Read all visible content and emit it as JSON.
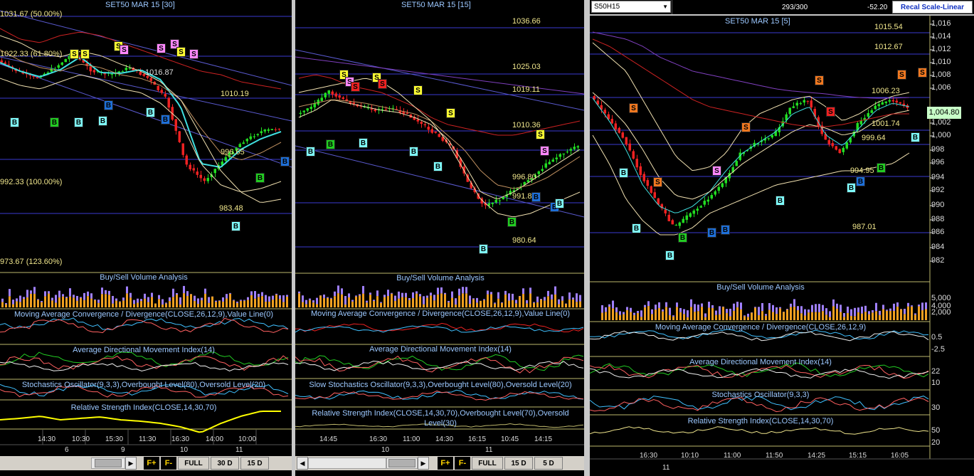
{
  "panels": [
    {
      "title": "SET50 MAR 15  [30]",
      "levels": [
        "1010.19",
        "996.65",
        "983.48",
        "1016.87"
      ],
      "fibs": [
        "1031.67 (50.00%)",
        "1022.33 (61.80%)",
        "992.33 (100.00%)",
        "973.67 (123.60%)"
      ],
      "indicators": [
        "Buy/Sell Volume Analysis",
        "Moving Average Convergence / Divergence(CLOSE,26,12,9),Value Line(0)",
        "Average Directional Movement Index(14)",
        "Stochastics Oscillator(9,3,3),Overbought Level(80),Oversold Level(20)",
        "Relative Strength Index(CLOSE,14,30,70)"
      ],
      "times": [
        "14:30",
        "10:30",
        "15:30",
        "11:30",
        "16:30",
        "14:00",
        "10:00"
      ],
      "dates": [
        "6",
        "9",
        "10",
        "11"
      ],
      "buttons": {
        "f_plus": "F+",
        "f_minus": "F-",
        "full": "FULL",
        "r1": "30 D",
        "r2": "15 D"
      }
    },
    {
      "title": "SET50 MAR 15  [15]",
      "levels": [
        "1036.66",
        "1025.03",
        "1019.11",
        "1010.36",
        "996.80",
        "991.89",
        "980.64"
      ],
      "indicators": [
        "Buy/Sell Volume Analysis",
        "Moving Average Convergence / Divergence(CLOSE,26,12,9),Value Line(0)",
        "Average Directional Movement Index(14)",
        "Slow Stochastics Oscillator(9,3,3),Overbought Level(80),Oversold Level(20)",
        "Relative Strength Index(CLOSE,14,30,70),Overbought Level(70),Oversold Level(30)"
      ],
      "times": [
        "14:45",
        "16:30",
        "11:00",
        "14:30",
        "16:15",
        "10:45",
        "14:15"
      ],
      "dates": [
        "10",
        "11"
      ],
      "buttons": {
        "f_plus": "F+",
        "f_minus": "F-",
        "full": "FULL",
        "r1": "15 D",
        "r2": "5 D"
      }
    },
    {
      "title": "SET50 MAR 15  [5]",
      "symbol": "S50H15",
      "counter": "293/300",
      "change": "-52.20",
      "recal": "Recal Scale-Linear",
      "price_tag": "1,004.80",
      "levels": [
        "1015.54",
        "1012.67",
        "1006.23",
        "1001.74",
        "999.64",
        "994.95",
        "987.01"
      ],
      "yaxis": [
        "1,016",
        "1,014",
        "1,012",
        "1,010",
        "1,008",
        "1,006",
        "1,002",
        "1,000",
        "998",
        "996",
        "994",
        "992",
        "990",
        "988",
        "986",
        "984",
        "982"
      ],
      "vol_axis": [
        "5,000",
        "4,000",
        "2,000"
      ],
      "macd_axis": [
        "0.5",
        "-2.5"
      ],
      "adx_axis": [
        "22",
        "10"
      ],
      "stoch_axis": [
        "30"
      ],
      "rsi_axis": [
        "50",
        "20"
      ],
      "indicators": [
        "Buy/Sell Volume Analysis",
        "Moving Average Convergence / Divergence(CLOSE,26,12,9)",
        "Average Directional Movement Index(14)",
        "Stochastics Oscillator(9,3,3)",
        "Relative Strength Index(CLOSE,14,30,70)"
      ],
      "times": [
        "16:30",
        "10:10",
        "11:00",
        "11:50",
        "14:25",
        "15:15",
        "16:05"
      ],
      "dates": [
        "11"
      ]
    }
  ],
  "colors": {
    "buy_cyan": "#7fffff",
    "buy_green": "#22cc22",
    "buy_blue": "#1e6fd8",
    "sell_yellow": "#ffff33",
    "sell_pink": "#ff88ff",
    "sell_red": "#ee2222",
    "sell_orange": "#f07820",
    "grid": "#3a3ad0",
    "rsi": "#ffff00"
  }
}
